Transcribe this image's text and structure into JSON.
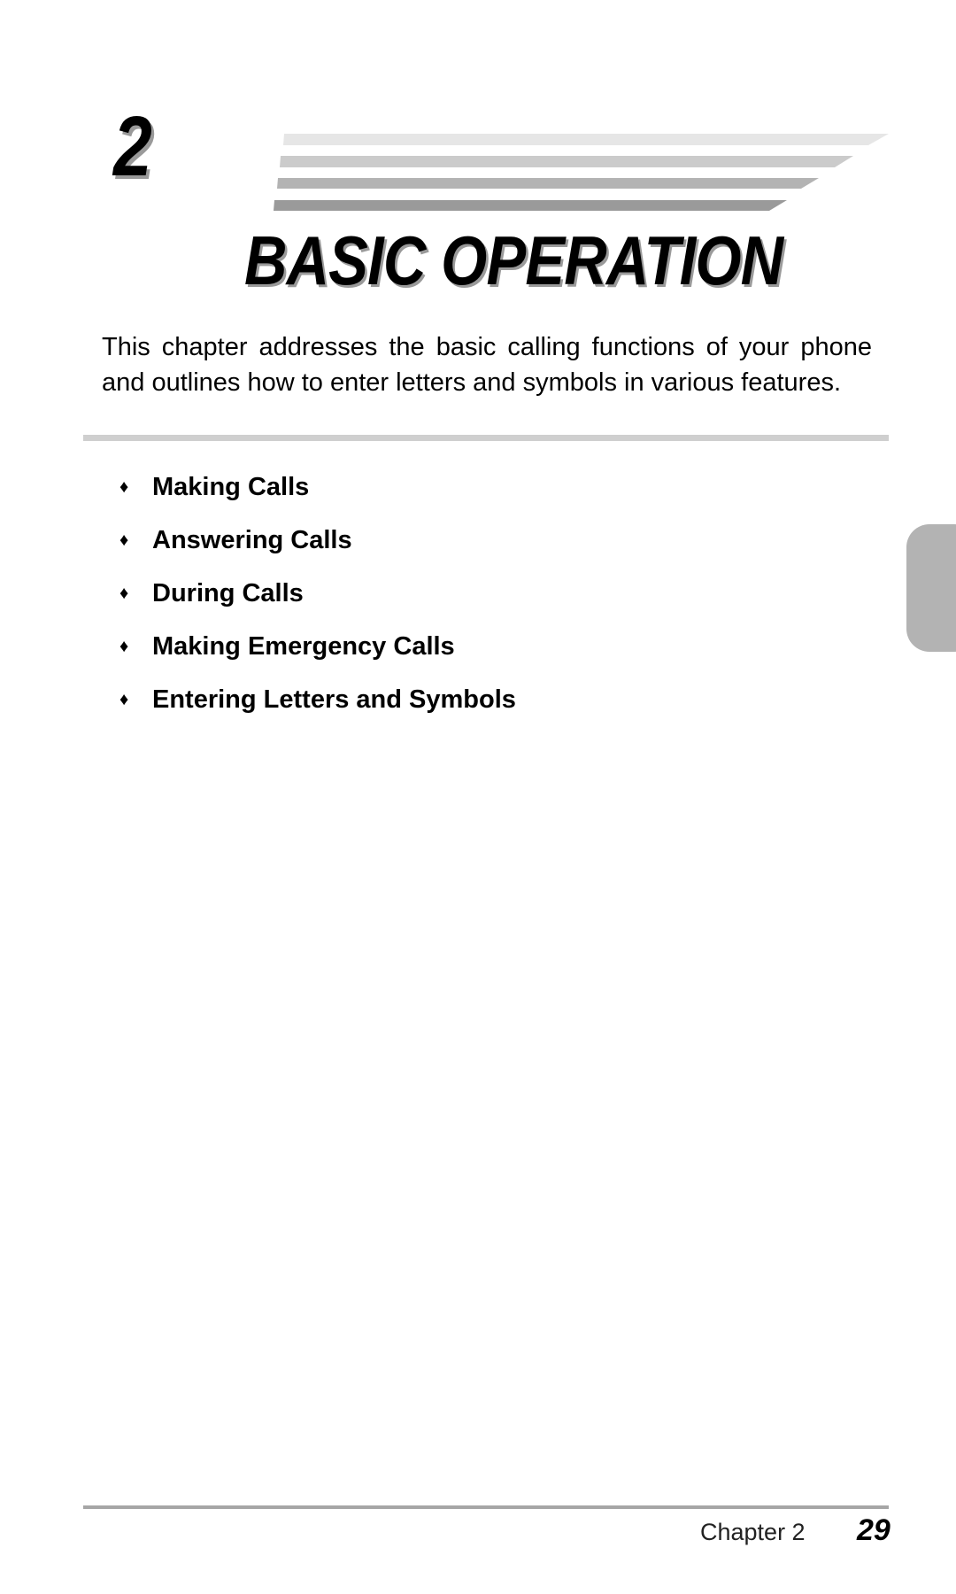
{
  "chapter": {
    "number": "2",
    "title": "BASIC OPERATION",
    "intro_lines": [
      "This chapter addresses the basic calling functions of your phone",
      "and outlines how to enter letters and symbols in various features."
    ],
    "bullet_icon": "diamond-bullet-icon",
    "bullet_glyph": "♦",
    "topics": [
      "Making Calls",
      "Answering Calls",
      "During Calls",
      "Making Emergency Calls",
      "Entering Letters and Symbols"
    ]
  },
  "footer": {
    "chapter_label": "Chapter 2",
    "page_number": "29"
  },
  "colors": {
    "stripe_1": "#e6e6e6",
    "stripe_2": "#cbcbcb",
    "stripe_3": "#b3b3b3",
    "stripe_4": "#9a9a9a",
    "separator": "#cfcfcf",
    "side_tab": "#b3b3b3",
    "text": "#000000"
  }
}
